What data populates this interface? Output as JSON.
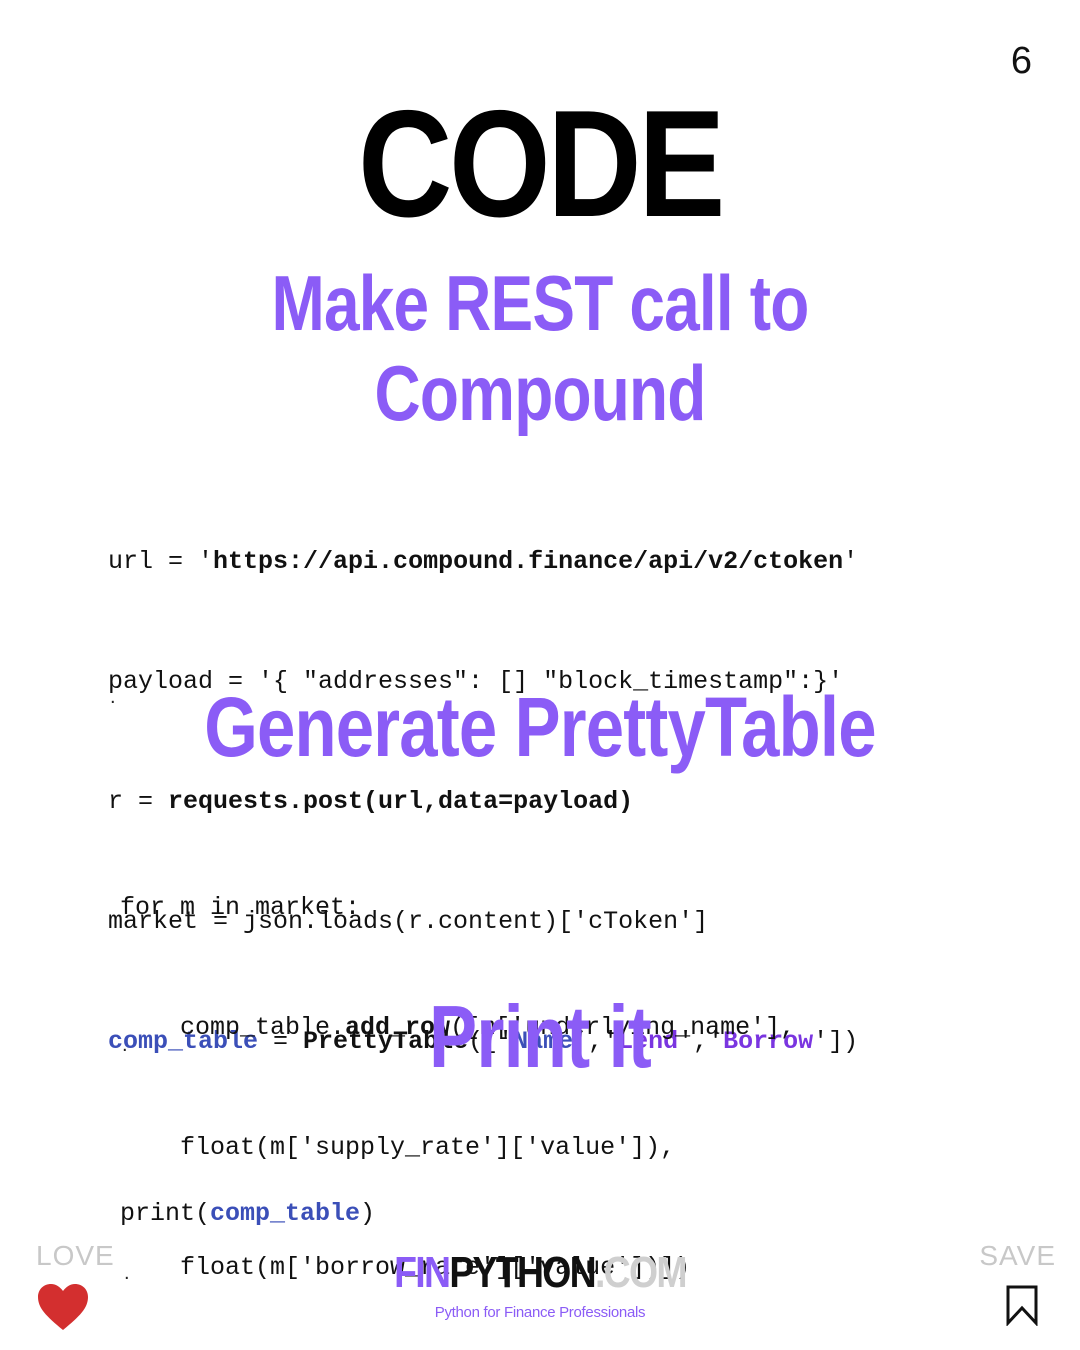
{
  "page_number": "6",
  "title": "CODE",
  "sections": {
    "rest_heading_line1": "Make REST call to",
    "rest_heading_line2": "Compound",
    "table_heading": "Generate PrettyTable",
    "print_heading": "Print it"
  },
  "code_block_1": {
    "l1_a": "url = '",
    "l1_b": "https://api.compound.finance/api/v2/ctoken",
    "l1_c": "'",
    "l2": "payload = '{ \"addresses\": [] \"block_timestamp\":}'",
    "l3_a": "r = ",
    "l3_b": "requests.post(url,data=payload)",
    "l4": "market = json.loads(r.content)['cToken']",
    "l5_var": "comp_table",
    "l5_eq": " = ",
    "l5_fn": "PrettyTable",
    "l5_open": "(['",
    "l5_name": "Name",
    "l5_sep1": "','",
    "l5_lend": "Lend",
    "l5_sep2": "','",
    "l5_borrow": "Borrow",
    "l5_close": "'])"
  },
  "code_block_2": {
    "l1": "for m in market:",
    "l2_a": "    comp_table.",
    "l2_b": "add_row",
    "l2_c": "([m['underlying_name'],",
    "l3": "    float(m['supply_rate']['value']),",
    "l4": "    float(m['borrow_rate']['value'])])"
  },
  "code_block_3": {
    "a": "print(",
    "b": "comp_table",
    "c": ")"
  },
  "dots": {
    "d1": ".",
    "d2": ".",
    "d3": "."
  },
  "footer": {
    "love_label": "LOVE",
    "save_label": "SAVE",
    "brand_fin": "FIN",
    "brand_python": "PYTHON",
    "brand_com": ".COM",
    "tagline": "Python for Finance Professionals"
  },
  "colors": {
    "accent_purple": "#8b5cf6",
    "code_blue": "#3b4fb8",
    "code_purple": "#7a35e0",
    "heart_red": "#d32f2f"
  },
  "icons": {
    "love": "heart-icon",
    "save": "bookmark-icon"
  }
}
